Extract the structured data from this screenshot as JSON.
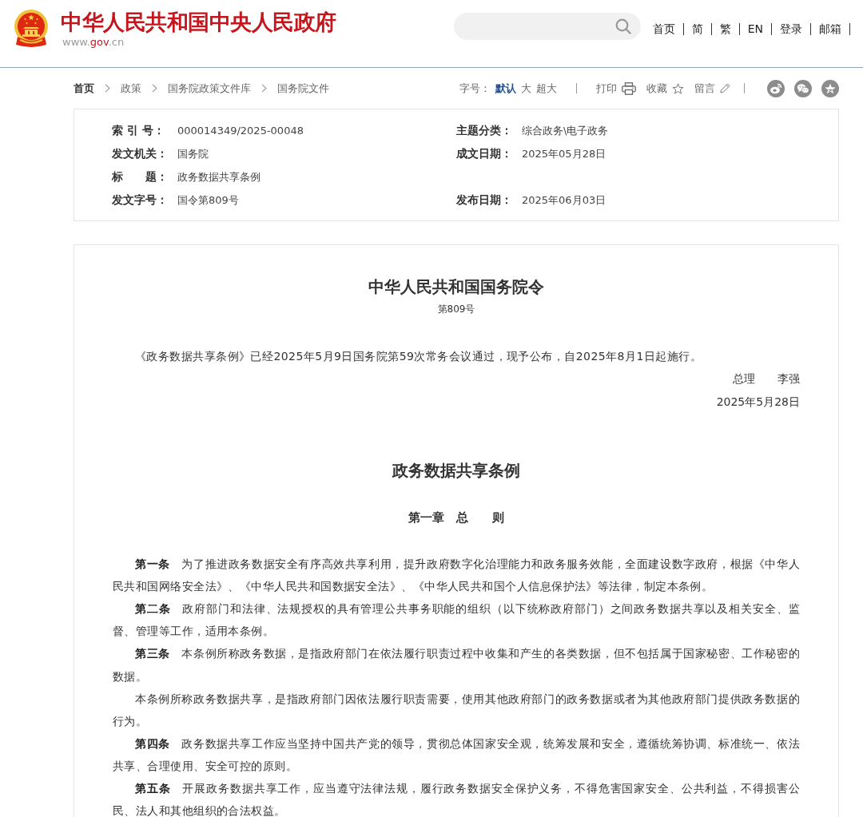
{
  "header": {
    "site_title": "中华人民共和国中央人民政府",
    "domain": {
      "prefix": "www.",
      "highlight": "gov",
      "suffix": ".cn"
    },
    "nav": [
      "首页",
      "简",
      "繁",
      "EN",
      "登录",
      "邮箱"
    ]
  },
  "breadcrumb": [
    "首页",
    "政策",
    "国务院政策文件库",
    "国务院文件"
  ],
  "toolbar": {
    "font_size_label": "字号：",
    "font_sizes": [
      {
        "label": "默认",
        "selected": true
      },
      {
        "label": "大",
        "selected": false
      },
      {
        "label": "超大",
        "selected": false
      }
    ],
    "actions": [
      {
        "kind": "print",
        "label": "打印"
      },
      {
        "kind": "favorite",
        "label": "收藏"
      },
      {
        "kind": "comment",
        "label": "留言"
      }
    ],
    "share": [
      {
        "kind": "weibo"
      },
      {
        "kind": "wechat"
      },
      {
        "kind": "qzone"
      }
    ]
  },
  "info": {
    "rows": [
      [
        {
          "label": "索 引 号：",
          "value": "000014349/2025-00048"
        },
        {
          "label": "主题分类：",
          "value": "综合政务\\电子政务"
        }
      ],
      [
        {
          "label": "发文机关：",
          "value": "国务院"
        },
        {
          "label": "成文日期：",
          "value": "2025年05月28日"
        }
      ],
      [
        {
          "label": "标　　题：",
          "value": "政务数据共享条例"
        }
      ],
      [
        {
          "label": "发文字号：",
          "value": "国令第809号"
        },
        {
          "label": "发布日期：",
          "value": "2025年06月03日"
        }
      ]
    ]
  },
  "document": {
    "decree_title": "中华人民共和国国务院令",
    "decree_number": "第809号",
    "preamble": "《政务数据共享条例》已经2025年5月9日国务院第59次常务会议通过，现予公布，自2025年8月1日起施行。",
    "signature": "总理　　李强",
    "date": "2025年5月28日",
    "law_title": "政务数据共享条例",
    "chapter": "第一章　总　　则",
    "paragraphs": [
      "**第一条**　为了推进政务数据安全有序高效共享利用，提升政府数字化治理能力和政务服务效能，全面建设数字政府，根据《中华人民共和国网络安全法》、《中华人民共和国数据安全法》、《中华人民共和国个人信息保护法》等法律，制定本条例。",
      "**第二条**　政府部门和法律、法规授权的具有管理公共事务职能的组织（以下统称政府部门）之间政务数据共享以及相关安全、监督、管理等工作，适用本条例。",
      "**第三条**　本条例所称政务数据，是指政府部门在依法履行职责过程中收集和产生的各类数据，但不包括属于国家秘密、工作秘密的数据。",
      "本条例所称政务数据共享，是指政府部门因依法履行职责需要，使用其他政府部门的政务数据或者为其他政府部门提供政务数据的行为。",
      "**第四条**　政务数据共享工作应当坚持中国共产党的领导，贯彻总体国家安全观，统筹发展和安全，遵循统筹协调、标准统一、依法共享、合理使用、安全可控的原则。",
      "**第五条**　开展政务数据共享工作，应当遵守法律法规，履行政务数据安全保护义务，不得危害国家安全、公共利益，不得损害公民、法人和其他组织的合法权益。"
    ]
  }
}
